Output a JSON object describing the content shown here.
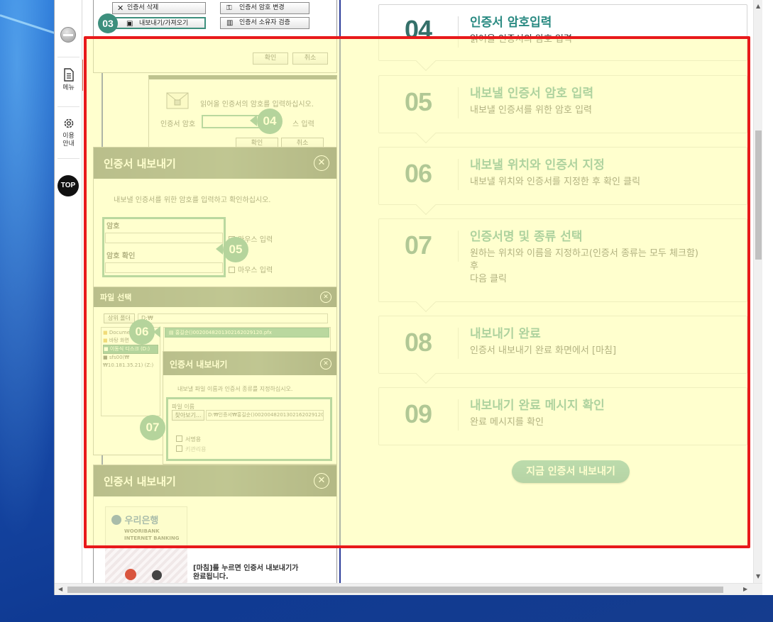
{
  "sidebar": {
    "menu_label": "메뉴",
    "guide_label_1": "이용",
    "guide_label_2": "안내",
    "top_label": "TOP"
  },
  "shots": {
    "top": {
      "delete_btn": "인증서 삭제",
      "password_change_btn": "인증서 암호 변경",
      "export_import_btn": "내보내기/가져오기",
      "owner_verify_btn": "인증서 소유자 검증",
      "ok": "확인",
      "cancel": "취소",
      "badge": "03"
    },
    "password": {
      "message": "읽어올 인증서의 암호를 입력하십시오.",
      "label": "인증서 암호",
      "suffix": "스 입력",
      "ok": "확인",
      "cancel": "취소",
      "badge": "04"
    },
    "export_dialog": {
      "title": "인증서 내보내기",
      "message": "내보낼 인증서를 위한 암호를 입력하고 확인하십시오.",
      "password_label": "암호",
      "confirm_label": "암호 확인",
      "mouse_input_1": "마우스 입력",
      "mouse_input_2": "마우스 입력",
      "badge": "05"
    },
    "file_dialog": {
      "title": "파일 선택",
      "up_folder": "상위 폴더",
      "path": "D:₩",
      "tree_items": [
        "Document",
        "바탕 화면",
        "이동식 디스크 (D:)",
        "sfs00(₩₩10.181.35.21) (Z:)"
      ],
      "file_name": "홍길순()0020048201302162029120.pfx",
      "badge": "06"
    },
    "name_dialog": {
      "title": "인증서 내보내기",
      "message": "내보낼 파일 이름과 인증서 종류를 지정하십시오.",
      "file_name_label": "파일 이름",
      "browse_btn": "찾아보기...",
      "file_path": "D:₩인증서₩홍길순()0020048201302162029120.pfx",
      "sign_label": "서명용",
      "key_label": "키관리용",
      "badge": "07"
    },
    "complete_dialog": {
      "title": "인증서 내보내기",
      "bank_name": "우리은행",
      "bank_en_1": "WOORIBANK",
      "bank_en_2": "INTERNET BANKING",
      "done_message_1": "[마침]를 누르면 인증서 내보내기가",
      "done_message_2": "완료됩니다."
    }
  },
  "steps": [
    {
      "num": "04",
      "title": "인증서 암호입력",
      "desc": [
        "읽어올 인증서의 암호 입력"
      ]
    },
    {
      "num": "05",
      "title": "내보낼 인증서 암호 입력",
      "desc": [
        "내보낼 인증서를 위한 암호 입력"
      ]
    },
    {
      "num": "06",
      "title": "내보낼 위치와 인증서 지정",
      "desc": [
        "내보낼 위치와 인증서를 지정한 후 확인 클릭"
      ]
    },
    {
      "num": "07",
      "title": "인증서명 및 종류 선택",
      "desc": [
        "원하는 위치와 이름을 지정하고(인증서 종류는 모두 체크함)",
        "후",
        "다음 클릭"
      ]
    },
    {
      "num": "08",
      "title": "내보내기 완료",
      "desc": [
        "인증서 내보내기 완료 화면에서 [마침]"
      ]
    },
    {
      "num": "09",
      "title": "내보내기 완료 메시지 확인",
      "desc": [
        "완료 메시지를 확인"
      ]
    }
  ],
  "cta_label": "지금 인증서 내보내기",
  "colors": {
    "accent_teal": "#2a8a82",
    "badge_green": "#3d8f7d",
    "highlight_red": "#e8191b",
    "highlight_tint": "#ffffb0",
    "dialog_header": "#4f5d56"
  }
}
